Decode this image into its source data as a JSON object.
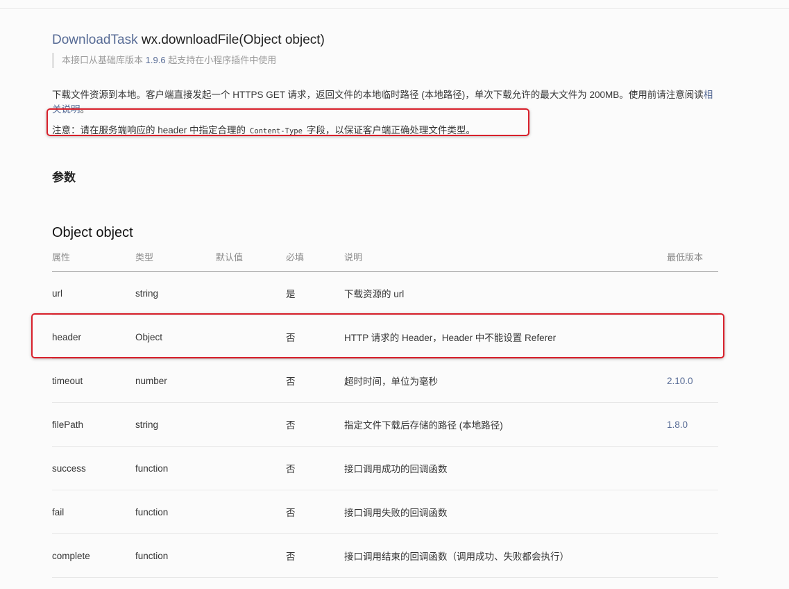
{
  "title": {
    "type_link": "DownloadTask",
    "signature": "wx.downloadFile(Object object)"
  },
  "support_note": {
    "prefix": "本接口从基础库版本",
    "version": "1.9.6",
    "suffix": "起支持在小程序插件中使用"
  },
  "description": {
    "text": "下载文件资源到本地。客户端直接发起一个 HTTPS GET 请求，返回文件的本地临时路径 (本地路径)，单次下载允许的最大文件为 200MB。使用前请注意阅读",
    "link": "相关说明",
    "end": "。"
  },
  "note": {
    "prefix": "注意：请在服务端响应的 header 中指定合理的",
    "code": "Content-Type",
    "suffix": "字段，以保证客户端正确处理文件类型。"
  },
  "section_params": "参数",
  "section_object": "Object object",
  "table": {
    "headers": [
      "属性",
      "类型",
      "默认值",
      "必填",
      "说明",
      "最低版本"
    ],
    "rows": [
      {
        "name": "url",
        "type": "string",
        "default": "",
        "required": "是",
        "desc": "下载资源的 url",
        "version": ""
      },
      {
        "name": "header",
        "type": "Object",
        "default": "",
        "required": "否",
        "desc": "HTTP 请求的 Header，Header 中不能设置 Referer",
        "version": ""
      },
      {
        "name": "timeout",
        "type": "number",
        "default": "",
        "required": "否",
        "desc": "超时时间，单位为毫秒",
        "version": "2.10.0"
      },
      {
        "name": "filePath",
        "type": "string",
        "default": "",
        "required": "否",
        "desc": "指定文件下载后存储的路径 (本地路径)",
        "version": "1.8.0"
      },
      {
        "name": "success",
        "type": "function",
        "default": "",
        "required": "否",
        "desc": "接口调用成功的回调函数",
        "version": ""
      },
      {
        "name": "fail",
        "type": "function",
        "default": "",
        "required": "否",
        "desc": "接口调用失败的回调函数",
        "version": ""
      },
      {
        "name": "complete",
        "type": "function",
        "default": "",
        "required": "否",
        "desc": "接口调用结束的回调函数（调用成功、失败都会执行）",
        "version": ""
      }
    ]
  },
  "colors": {
    "link": "#576b95",
    "highlight_border": "#d8202b",
    "text": "#353535",
    "muted": "#9a9a9a"
  }
}
